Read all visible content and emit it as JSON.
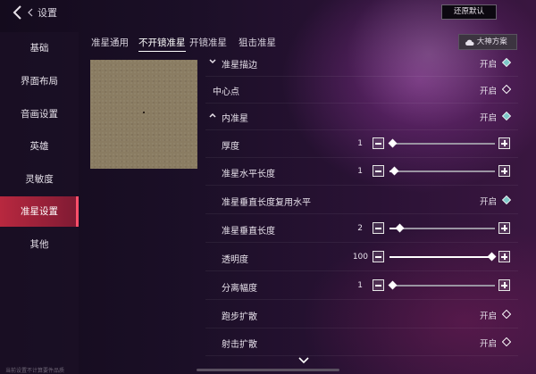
{
  "header": {
    "title": "设置",
    "reset_label": "还原默认"
  },
  "sidebar": {
    "items": [
      {
        "label": "基础",
        "active": false
      },
      {
        "label": "界面布局",
        "active": false
      },
      {
        "label": "音画设置",
        "active": false
      },
      {
        "label": "英雄",
        "active": false
      },
      {
        "label": "灵敏度",
        "active": false
      },
      {
        "label": "准星设置",
        "active": true
      },
      {
        "label": "其他",
        "active": false
      }
    ],
    "footnote": "当前设置不计算要件品质"
  },
  "tabs": [
    {
      "label": "准星通用",
      "active": false
    },
    {
      "label": "不开镜准星",
      "active": true
    },
    {
      "label": "开镜准星",
      "active": false
    },
    {
      "label": "狙击准星",
      "active": false
    }
  ],
  "scheme_button": {
    "label": "大神方案",
    "icon": "cloud-icon"
  },
  "settings": {
    "outline": {
      "label": "准星描边",
      "state": "开启"
    },
    "center_dot": {
      "label": "中心点",
      "state": "开启"
    },
    "inner": {
      "label": "内准星",
      "state": "开启"
    },
    "thickness": {
      "label": "厚度",
      "value": "1",
      "fraction": 0.0
    },
    "h_length": {
      "label": "准星水平长度",
      "value": "1",
      "fraction": 0.05
    },
    "v_reuse": {
      "label": "准星垂直长度复用水平",
      "state": "开启"
    },
    "v_length": {
      "label": "准星垂直长度",
      "value": "2",
      "fraction": 0.1
    },
    "opacity": {
      "label": "透明度",
      "value": "100",
      "fraction": 1.0
    },
    "spacing": {
      "label": "分离幅度",
      "value": "1",
      "fraction": 0.0
    },
    "run_spread": {
      "label": "跑步扩散",
      "state": "开启"
    },
    "fire_spread": {
      "label": "射击扩散",
      "state": "开启"
    }
  },
  "colors": {
    "accent": "#b8283f",
    "checked": "#7ec8c8"
  }
}
